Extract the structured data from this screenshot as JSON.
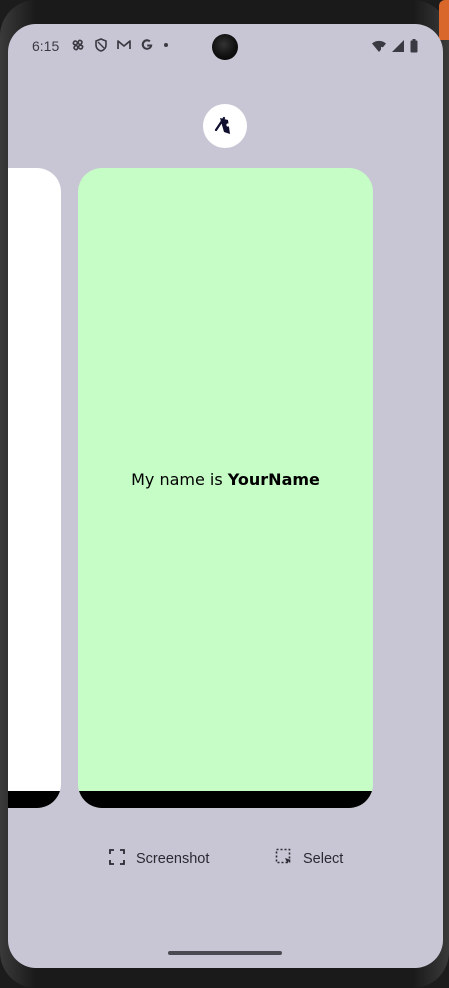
{
  "status_bar": {
    "time": "6:15",
    "left_icons": [
      "fan-icon",
      "shield-icon",
      "gmail-icon",
      "google-icon",
      "dot-icon"
    ],
    "right_icons": [
      "wifi-icon",
      "signal-icon",
      "battery-icon"
    ]
  },
  "recents": {
    "app_icon": "app-logo-icon",
    "main_card": {
      "text_prefix": "My name is ",
      "text_name": "YourName",
      "background": "#c6fdc6"
    },
    "left_card": {
      "background": "#ffffff"
    }
  },
  "actions": {
    "screenshot_label": "Screenshot",
    "select_label": "Select"
  },
  "colors": {
    "screen_background": "#c8c6d4",
    "card_green": "#c6fdc6"
  }
}
